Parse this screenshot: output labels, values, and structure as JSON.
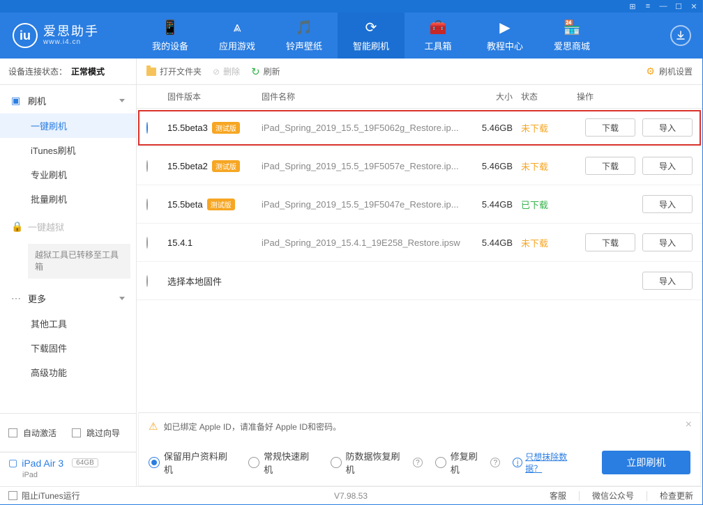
{
  "app": {
    "name": "爱思助手",
    "domain": "www.i4.cn",
    "version_label": "V7.98.53"
  },
  "nav": {
    "items": [
      {
        "label": "我的设备",
        "icon": "📱"
      },
      {
        "label": "应用游戏",
        "icon": "⩓"
      },
      {
        "label": "铃声壁纸",
        "icon": "🎵"
      },
      {
        "label": "智能刷机",
        "icon": "⟳",
        "active": true
      },
      {
        "label": "工具箱",
        "icon": "🧰"
      },
      {
        "label": "教程中心",
        "icon": "▶"
      },
      {
        "label": "爱思商城",
        "icon": "🏪"
      }
    ]
  },
  "toolbar": {
    "open_folder": "打开文件夹",
    "delete": "删除",
    "refresh": "刷新",
    "settings": "刷机设置"
  },
  "connection": {
    "prefix": "设备连接状态：",
    "mode": "正常模式"
  },
  "sidebar": {
    "flash_group": "刷机",
    "flash_items": [
      "一键刷机",
      "iTunes刷机",
      "专业刷机",
      "批量刷机"
    ],
    "active_index": 0,
    "jailbreak_group": "一键越狱",
    "jailbreak_note": "越狱工具已转移至工具箱",
    "more_group": "更多",
    "more_items": [
      "其他工具",
      "下载固件",
      "高级功能"
    ],
    "auto_activate": "自动激活",
    "skip_guide": "跳过向导"
  },
  "device": {
    "name": "iPad Air 3",
    "storage": "64GB",
    "type": "iPad"
  },
  "table_head": {
    "version": "固件版本",
    "name": "固件名称",
    "size": "大小",
    "status": "状态",
    "ops": "操作"
  },
  "firmware": [
    {
      "version": "15.5beta3",
      "beta": true,
      "file": "iPad_Spring_2019_15.5_19F5062g_Restore.ip...",
      "size": "5.46GB",
      "status": "未下载",
      "status_type": "pending",
      "selected": true,
      "highlight": true,
      "has_download": true
    },
    {
      "version": "15.5beta2",
      "beta": true,
      "file": "iPad_Spring_2019_15.5_19F5057e_Restore.ip...",
      "size": "5.46GB",
      "status": "未下载",
      "status_type": "pending",
      "selected": false,
      "highlight": false,
      "has_download": true
    },
    {
      "version": "15.5beta",
      "beta": true,
      "file": "iPad_Spring_2019_15.5_19F5047e_Restore.ip...",
      "size": "5.44GB",
      "status": "已下载",
      "status_type": "done",
      "selected": false,
      "highlight": false,
      "has_download": false
    },
    {
      "version": "15.4.1",
      "beta": false,
      "file": "iPad_Spring_2019_15.4.1_19E258_Restore.ipsw",
      "size": "5.44GB",
      "status": "未下载",
      "status_type": "pending",
      "selected": false,
      "highlight": false,
      "has_download": true
    }
  ],
  "beta_tag_text": "测试版",
  "local_firmware": "选择本地固件",
  "op": {
    "download": "下载",
    "import": "导入"
  },
  "notice": "如已绑定 Apple ID，请准备好 Apple ID和密码。",
  "flash_options": [
    {
      "label": "保留用户资料刷机",
      "checked": true
    },
    {
      "label": "常规快速刷机",
      "checked": false
    },
    {
      "label": "防数据恢复刷机",
      "checked": false,
      "help": true
    },
    {
      "label": "修复刷机",
      "checked": false,
      "help": true
    }
  ],
  "erase_link": "只想抹除数据？",
  "flash_button": "立即刷机",
  "statusbar": {
    "block_itunes": "阻止iTunes运行",
    "kefu": "客服",
    "wechat": "微信公众号",
    "update": "检查更新"
  }
}
